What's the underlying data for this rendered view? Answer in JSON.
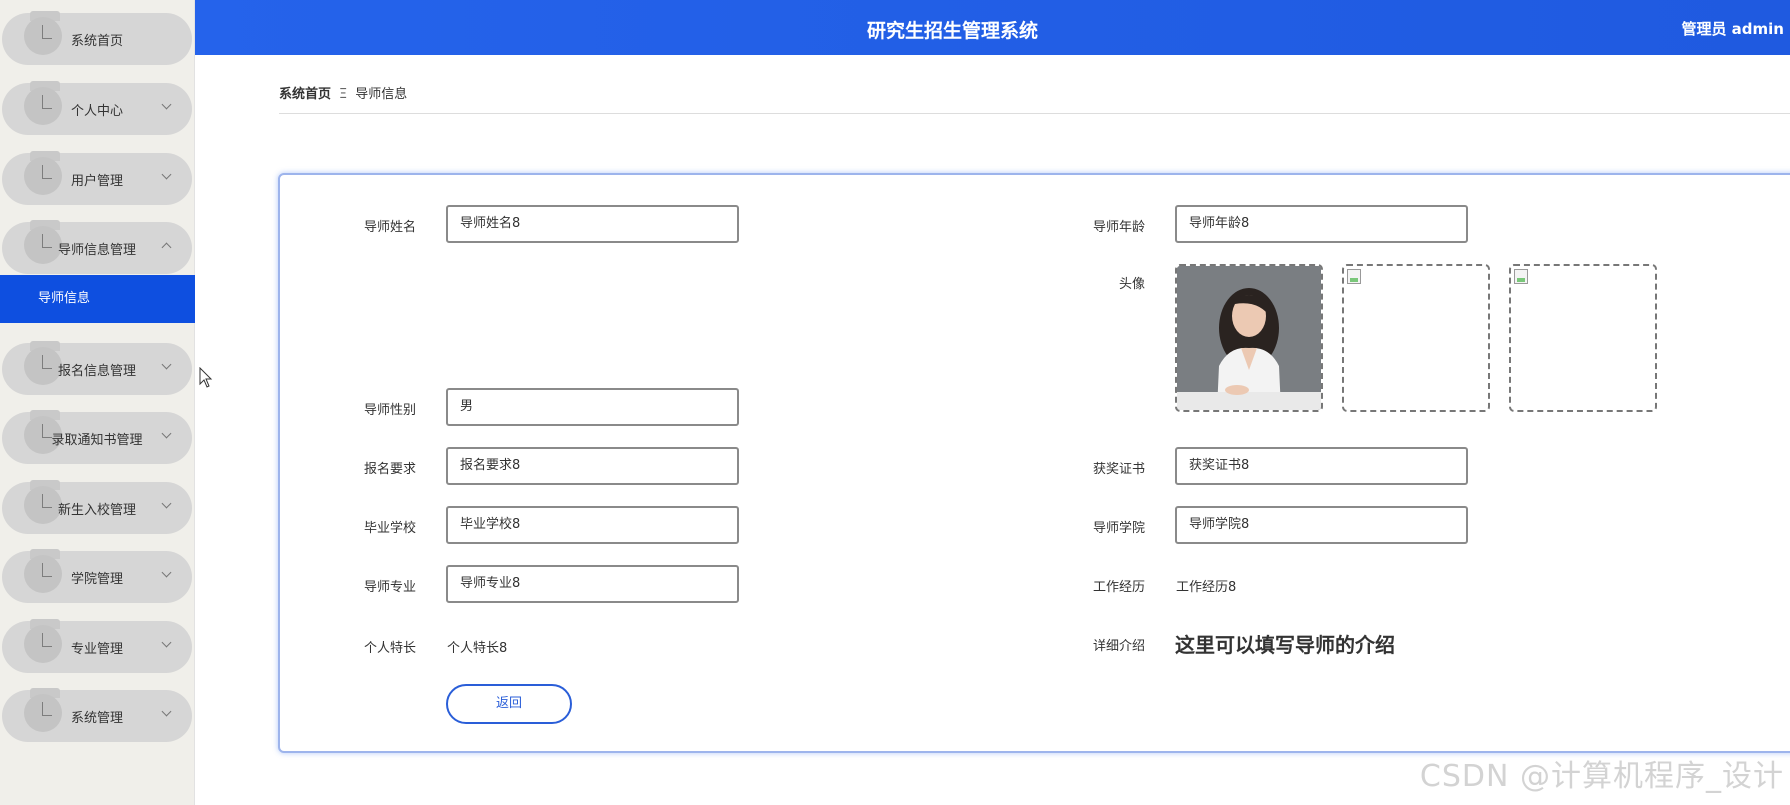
{
  "header": {
    "title": "研究生招生管理系统",
    "user": "管理员 admin"
  },
  "sidebar": {
    "items": [
      {
        "label": "系统首页",
        "chevron": "none"
      },
      {
        "label": "个人中心",
        "chevron": "down"
      },
      {
        "label": "用户管理",
        "chevron": "down"
      },
      {
        "label": "导师信息管理",
        "chevron": "up"
      },
      {
        "label": "报名信息管理",
        "chevron": "down"
      },
      {
        "label": "录取通知书管理",
        "chevron": "down"
      },
      {
        "label": "新生入校管理",
        "chevron": "down"
      },
      {
        "label": "学院管理",
        "chevron": "down"
      },
      {
        "label": "专业管理",
        "chevron": "down"
      },
      {
        "label": "系统管理",
        "chevron": "down"
      }
    ],
    "active_sub": "导师信息"
  },
  "breadcrumb": {
    "home": "系统首页",
    "separator": "Ξ",
    "current": "导师信息"
  },
  "form": {
    "name": {
      "label": "导师姓名",
      "value": "导师姓名8"
    },
    "age": {
      "label": "导师年龄",
      "value": "导师年龄8"
    },
    "avatar": {
      "label": "头像",
      "images": [
        "woman-portrait",
        "broken-image",
        "broken-image"
      ]
    },
    "gender": {
      "label": "导师性别",
      "value": "男"
    },
    "requirement": {
      "label": "报名要求",
      "value": "报名要求8"
    },
    "award": {
      "label": "获奖证书",
      "value": "获奖证书8"
    },
    "school": {
      "label": "毕业学校",
      "value": "毕业学校8"
    },
    "college": {
      "label": "导师学院",
      "value": "导师学院8"
    },
    "major": {
      "label": "导师专业",
      "value": "导师专业8"
    },
    "experience": {
      "label": "工作经历",
      "value": "工作经历8"
    },
    "specialty": {
      "label": "个人特长",
      "value": "个人特长8"
    },
    "intro": {
      "label": "详细介绍",
      "value": "这里可以填写导师的介绍"
    },
    "back_label": "返回"
  },
  "watermark": "CSDN @计算机程序_设计",
  "colors": {
    "header": "#2563eb",
    "active": "#0e4fe0",
    "button": "#2a5ed8"
  }
}
